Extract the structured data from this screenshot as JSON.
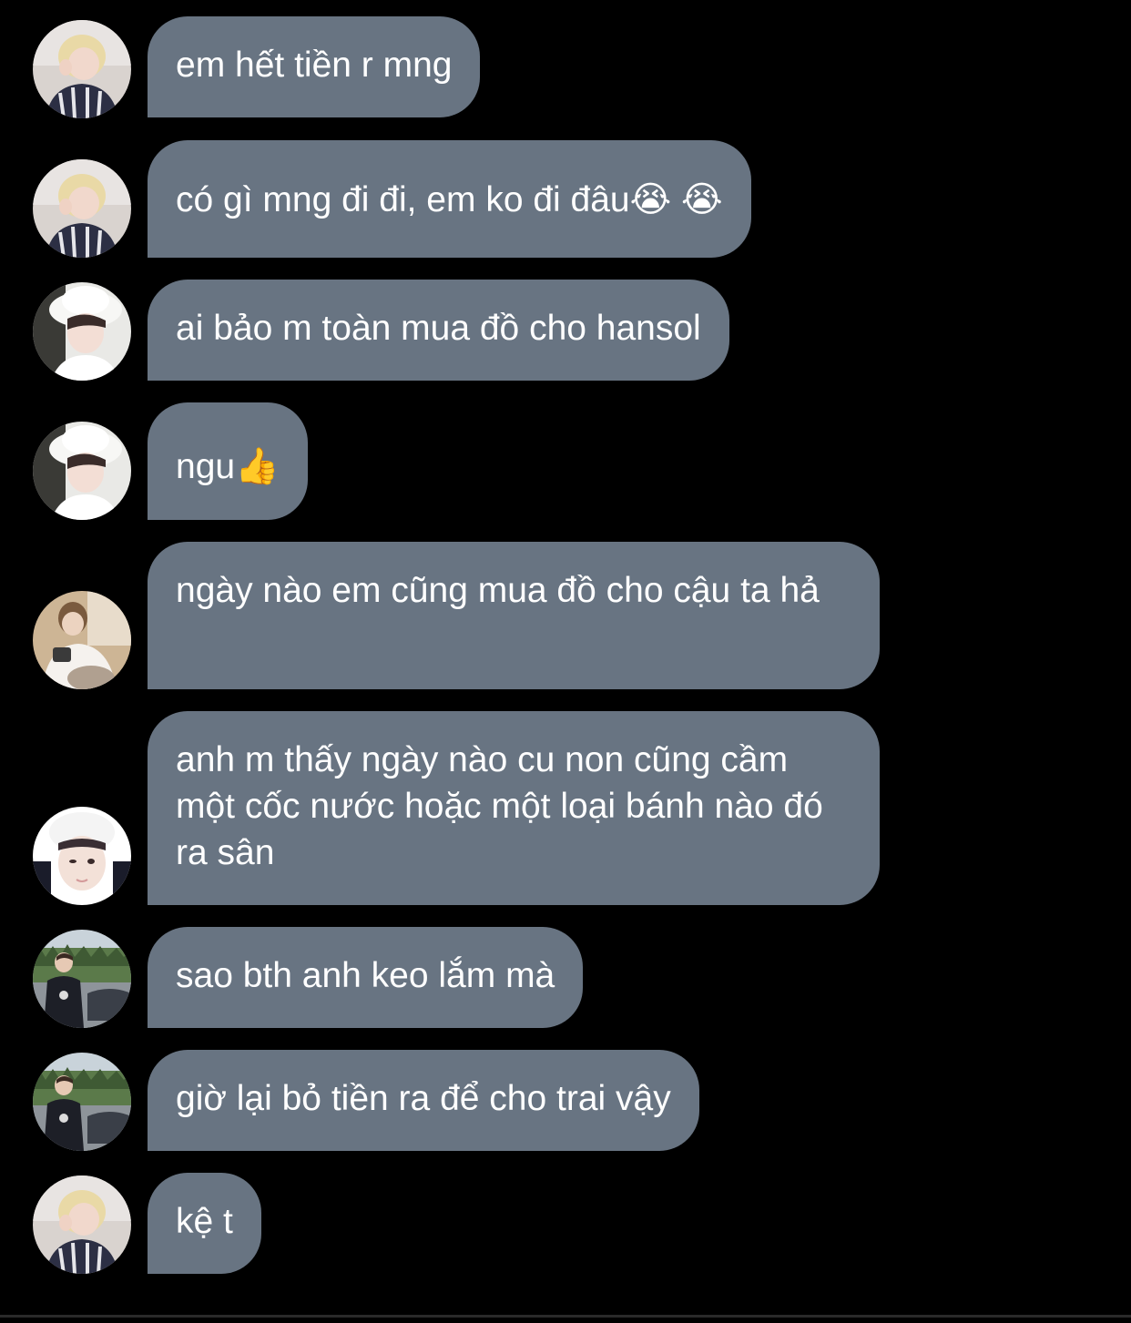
{
  "messages": [
    {
      "sender": "blonde-striped",
      "text": "em hết tiền r mng"
    },
    {
      "sender": "blonde-striped",
      "text": "có gì mng đi đi, em ko đi đâu😭 😭"
    },
    {
      "sender": "white-bucket-hat",
      "text": "ai bảo m toàn mua đồ cho hansol"
    },
    {
      "sender": "white-bucket-hat",
      "text": "ngu👍"
    },
    {
      "sender": "cream-room",
      "text": "ngày nào em cũng mua đồ cho cậu ta hả"
    },
    {
      "sender": "white-beanie",
      "text": "anh m thấy ngày nào cu non cũng cầm một cốc nước hoặc một loại bánh nào đó ra sân"
    },
    {
      "sender": "outdoor-car",
      "text": "sao bth anh keo lắm mà"
    },
    {
      "sender": "outdoor-car",
      "text": "giờ lại bỏ tiền ra để cho trai vậy"
    },
    {
      "sender": "blonde-striped",
      "text": "kệ t"
    }
  ],
  "colors": {
    "background": "#000000",
    "bubble": "#687482",
    "text": "#ffffff"
  },
  "icons": [
    "avatar-blonde-striped",
    "avatar-white-bucket-hat",
    "avatar-cream-room",
    "avatar-white-beanie",
    "avatar-outdoor-car"
  ]
}
